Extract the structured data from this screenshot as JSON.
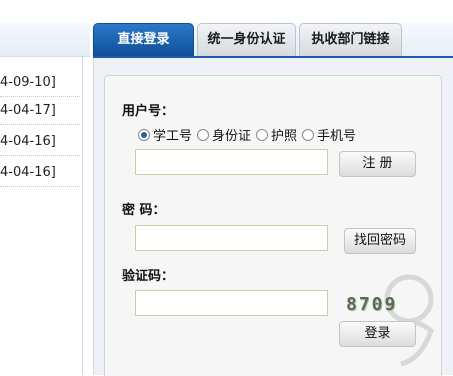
{
  "news": {
    "dates": [
      "4-09-10]",
      "4-04-17]",
      "4-04-16]",
      "4-04-16]"
    ]
  },
  "tabs": [
    {
      "label": "直接登录",
      "active": true
    },
    {
      "label": "统一身份认证",
      "active": false
    },
    {
      "label": "执收部门链接",
      "active": false
    }
  ],
  "login": {
    "username_label": "用户号：",
    "id_types": [
      {
        "label": "学工号",
        "checked": true
      },
      {
        "label": "身份证",
        "checked": false
      },
      {
        "label": "护照",
        "checked": false
      },
      {
        "label": "手机号",
        "checked": false
      }
    ],
    "username_value": "",
    "register_label": "注 册",
    "password_label": "密  码：",
    "password_value": "",
    "recover_label": "找回密码",
    "captcha_label": "验证码：",
    "captcha_value": "",
    "captcha_image_text": "8709",
    "login_label": "登录"
  },
  "colors": {
    "active_tab": "#1c5aa5",
    "input_border": "#d7c9a8",
    "captcha_text": "#5a6b55"
  }
}
